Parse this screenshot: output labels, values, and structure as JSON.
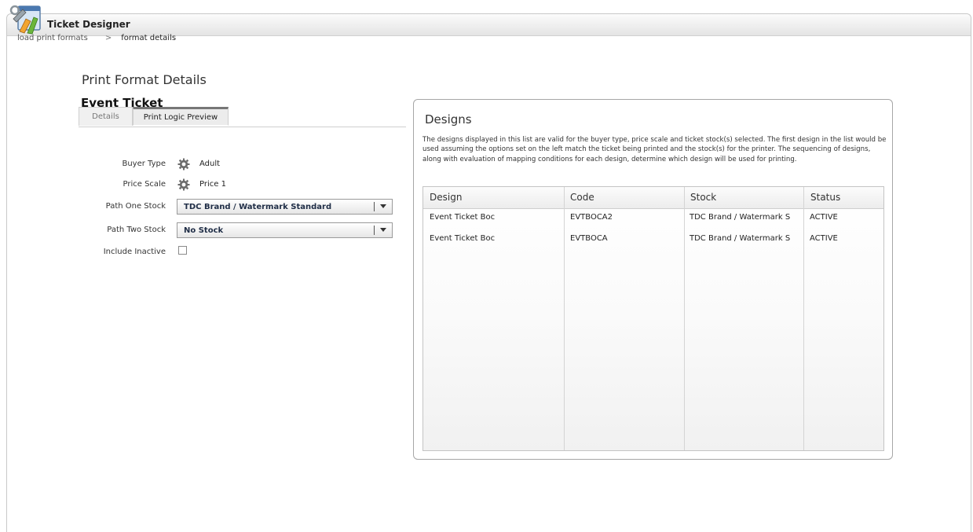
{
  "app": {
    "title": "Ticket Designer"
  },
  "breadcrumb": {
    "items": [
      "load print formats",
      "format details"
    ],
    "separator": ">"
  },
  "page": {
    "title": "Print Format Details",
    "entity_name": "Event Ticket"
  },
  "tabs": [
    {
      "label": "Details",
      "active": false
    },
    {
      "label": "Print Logic Preview",
      "active": true
    }
  ],
  "form": {
    "buyer_type": {
      "label": "Buyer Type",
      "value": "Adult"
    },
    "price_scale": {
      "label": "Price Scale",
      "value": "Price 1"
    },
    "path_one_stock": {
      "label": "Path One Stock",
      "value": "TDC Brand / Watermark Standard"
    },
    "path_two_stock": {
      "label": "Path Two Stock",
      "value": "No Stock"
    },
    "include_inactive": {
      "label": "Include Inactive",
      "checked": false
    }
  },
  "designs": {
    "title": "Designs",
    "description": "The designs displayed in this list are valid for the buyer type, price scale and ticket stock(s) selected.  The first design in the list would be used assuming the options set on the left match the ticket being printed and the stock(s) for the printer.  The sequencing of designs, along with evaluation of mapping conditions for each design, determine which design will be used for printing.",
    "columns": [
      "Design",
      "Code",
      "Stock",
      "Status"
    ],
    "rows": [
      [
        "Event Ticket Boc",
        "EVTBOCA2",
        "TDC Brand / Watermark S",
        "ACTIVE"
      ],
      [
        "Event Ticket Boc",
        "EVTBOCA",
        "TDC Brand / Watermark S",
        "ACTIVE"
      ]
    ]
  },
  "icons": {
    "app": "ticket-designer-app-icon",
    "setting": "gear-icon",
    "dropdown": "chevron-down-icon"
  },
  "colors": {
    "select_text": "#1f2d46",
    "tab_active_bar": "#777777"
  }
}
